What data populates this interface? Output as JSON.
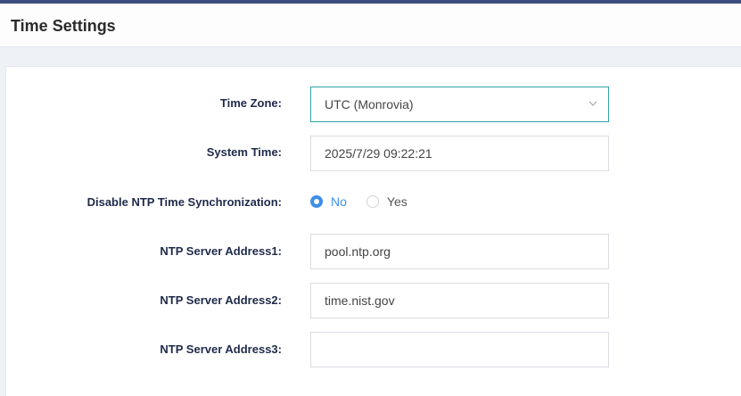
{
  "header": {
    "title": "Time Settings"
  },
  "form": {
    "time_zone": {
      "label": "Time Zone:",
      "value": "UTC (Monrovia)"
    },
    "system_time": {
      "label": "System Time:",
      "value": "2025/7/29 09:22:21"
    },
    "disable_ntp": {
      "label": "Disable NTP Time Synchronization:",
      "options": {
        "no": "No",
        "yes": "Yes"
      },
      "selected": "No"
    },
    "ntp1": {
      "label": "NTP Server Address1:",
      "value": "pool.ntp.org"
    },
    "ntp2": {
      "label": "NTP Server Address2:",
      "value": "time.nist.gov"
    },
    "ntp3": {
      "label": "NTP Server Address3:",
      "value": ""
    }
  },
  "colors": {
    "accent": "#3d8ee9",
    "select_border": "#2fa3a8",
    "top_bar": "#3b4e7e"
  },
  "icons": {
    "select_toggle": "chevron-down-icon"
  }
}
